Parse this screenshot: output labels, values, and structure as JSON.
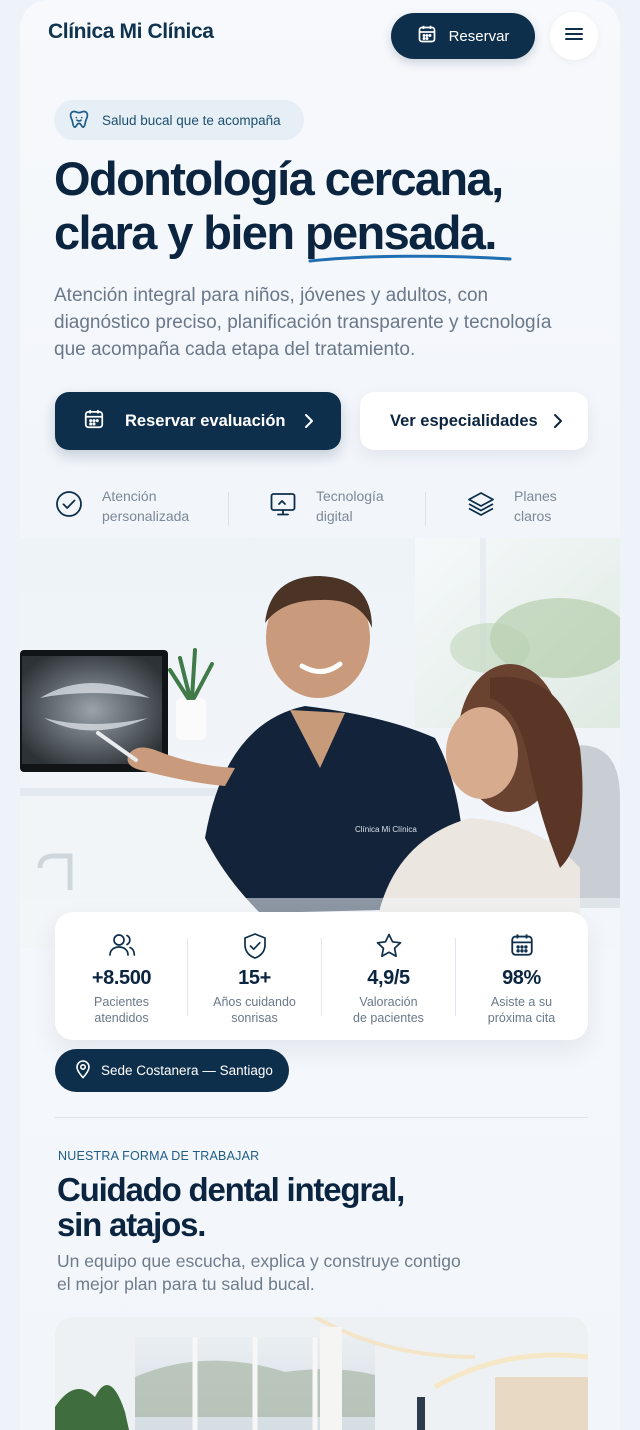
{
  "header": {
    "brand": "Clínica Mi Clínica",
    "reserve_label": "Reservar",
    "calendar_icon": "calendar-icon",
    "menu_icon": "menu-icon"
  },
  "hero": {
    "badge": "Salud bucal que te acompaña",
    "title_line1": "Odontología cercana,",
    "title_line2": "clara y bien pensada.",
    "subtitle": "Atención integral para niños, jóvenes y adultos, con diagnóstico preciso, planificación transparente y tecnología que acompaña cada etapa del tratamiento.",
    "primary_cta": "Reservar evaluación",
    "secondary_cta": "Ver especialidades"
  },
  "features": [
    {
      "icon": "check-circle-icon",
      "line1": "Atención",
      "line2": "personalizada"
    },
    {
      "icon": "monitor-icon",
      "line1": "Tecnología",
      "line2": "digital"
    },
    {
      "icon": "layers-icon",
      "line1": "Planes",
      "line2": "claros"
    }
  ],
  "photo": {
    "scrub_text": "Clínica Mi Clínica"
  },
  "stats": [
    {
      "icon": "users-icon",
      "value": "+8.500",
      "line1": "Pacientes",
      "line2": "atendidos"
    },
    {
      "icon": "shield-check-icon",
      "value": "15+",
      "line1": "Años cuidando",
      "line2": "sonrisas"
    },
    {
      "icon": "star-icon",
      "value": "4,9/5",
      "line1": "Valoración",
      "line2": "de pacientes"
    },
    {
      "icon": "calendar-icon",
      "value": "98%",
      "line1": "Asiste a su",
      "line2": "próxima cita"
    }
  ],
  "location": "Sede Costanera — Santiago",
  "section": {
    "eyebrow": "NUESTRA FORMA DE TRABAJAR",
    "title_line1": "Cuidado dental integral,",
    "title_line2": "sin atajos.",
    "subtitle_line1": "Un equipo que escucha, explica y construye contigo",
    "subtitle_line2": "el mejor plan para tu salud bucal."
  },
  "colors": {
    "navy": "#0e2f4b",
    "accent_blue": "#1f6fb2",
    "text_muted": "#6a7889"
  }
}
